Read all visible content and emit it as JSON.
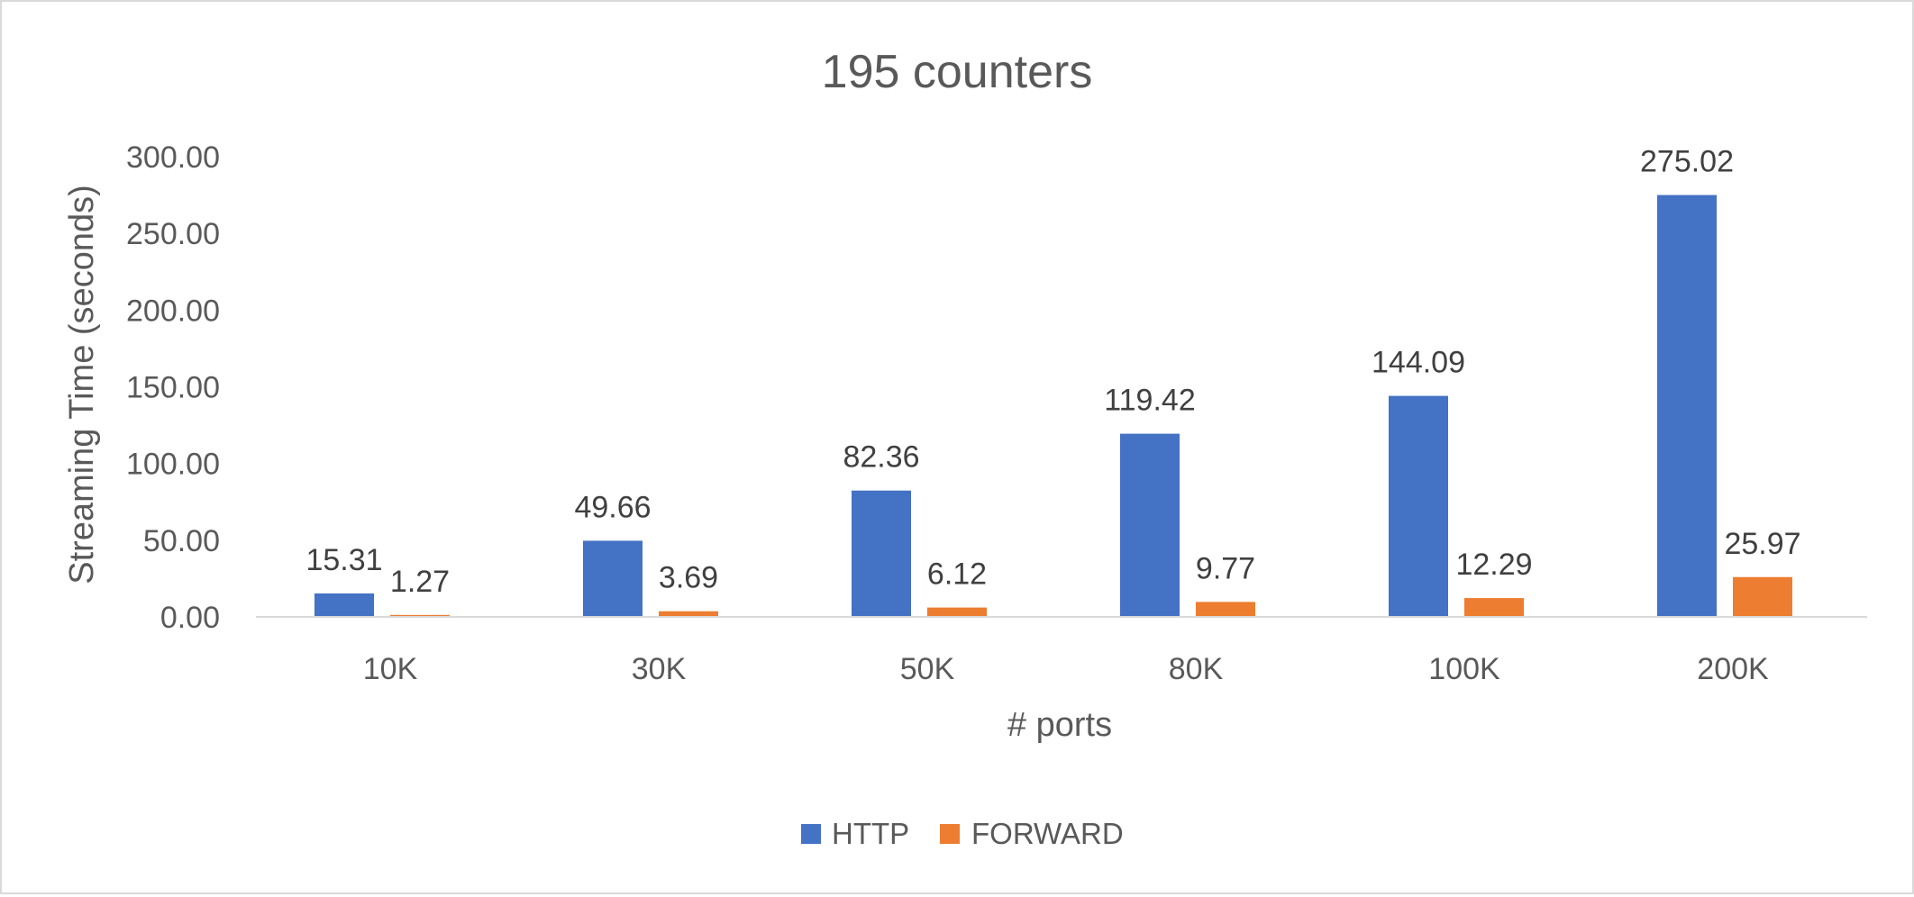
{
  "chart_data": {
    "type": "bar",
    "title": "195 counters",
    "xlabel": "# ports",
    "ylabel": "Streaming Time (seconds)",
    "categories": [
      "10K",
      "30K",
      "50K",
      "80K",
      "100K",
      "200K"
    ],
    "series": [
      {
        "name": "HTTP",
        "color": "#4472c4",
        "values": [
          15.31,
          49.66,
          82.36,
          119.42,
          144.09,
          275.02
        ],
        "labels": [
          "15.31",
          "49.66",
          "82.36",
          "119.42",
          "144.09",
          "275.02"
        ]
      },
      {
        "name": "FORWARD",
        "color": "#ed7d31",
        "values": [
          1.27,
          3.69,
          6.12,
          9.77,
          12.29,
          25.97
        ],
        "labels": [
          "1.27",
          "3.69",
          "6.12",
          "9.77",
          "12.29",
          "25.97"
        ]
      }
    ],
    "ylim": [
      0,
      300
    ],
    "yticks": [
      "0.00",
      "50.00",
      "100.00",
      "150.00",
      "200.00",
      "250.00",
      "300.00"
    ],
    "grid": false,
    "legend": "bottom-center"
  }
}
